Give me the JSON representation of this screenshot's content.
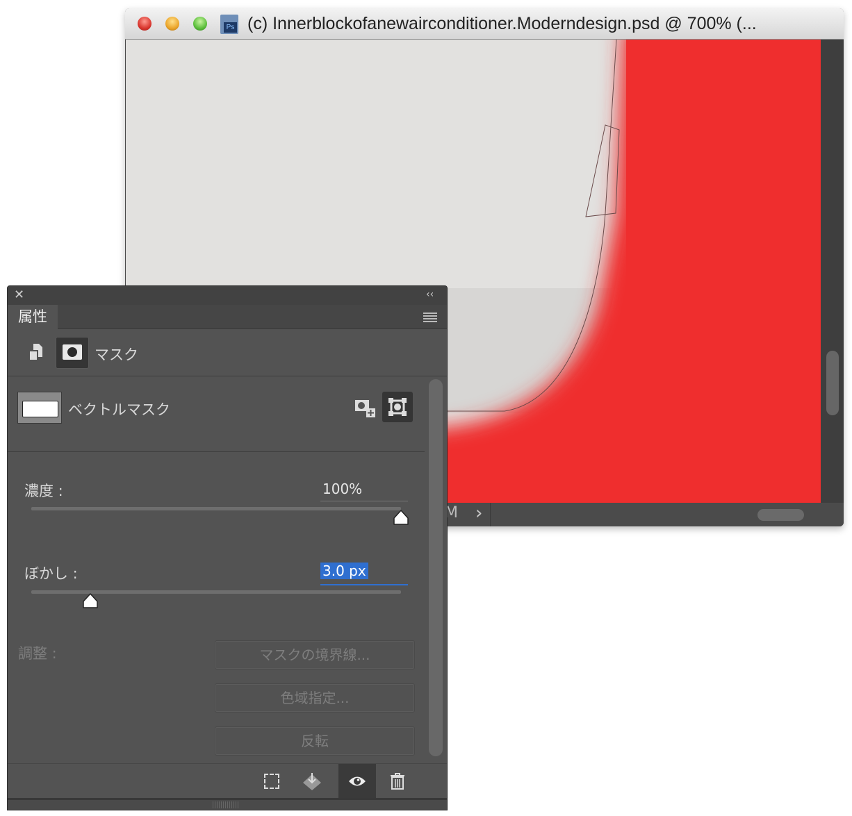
{
  "document_window": {
    "title": "(c) Innerblockofanewairconditioner.Moderndesign.psd @ 700% (...",
    "file_icon": "photoshop-file-icon",
    "traffic_lights": {
      "close": "#e0443e",
      "minimize": "#f0b030",
      "zoom": "#4fbf40"
    },
    "canvas_colors": {
      "background": "#e2e1df",
      "fill": "#ef2e2e"
    },
    "status_partial": "M",
    "status_arrow": "›"
  },
  "panel": {
    "close_icon": "close-icon",
    "collapse_label": "‹‹",
    "tab_label": "属性",
    "menu_icon": "hamburger-menu-icon",
    "mode_label": "マスク",
    "mask_type_label": "ベクトルマスク",
    "density": {
      "label": "濃度 :",
      "value": "100%",
      "percent": 100
    },
    "feather": {
      "label": "ぼかし :",
      "value": "3.0 px",
      "fraction": 0.16
    },
    "adjust_label": "調整 :",
    "buttons": {
      "mask_edge": "マスクの境界線...",
      "color_range": "色域指定...",
      "invert": "反転"
    },
    "footer_icons": [
      "selection-from-mask-icon",
      "apply-mask-icon",
      "visibility-eye-icon",
      "trash-icon"
    ],
    "selection_color": "#2f6fd0"
  }
}
